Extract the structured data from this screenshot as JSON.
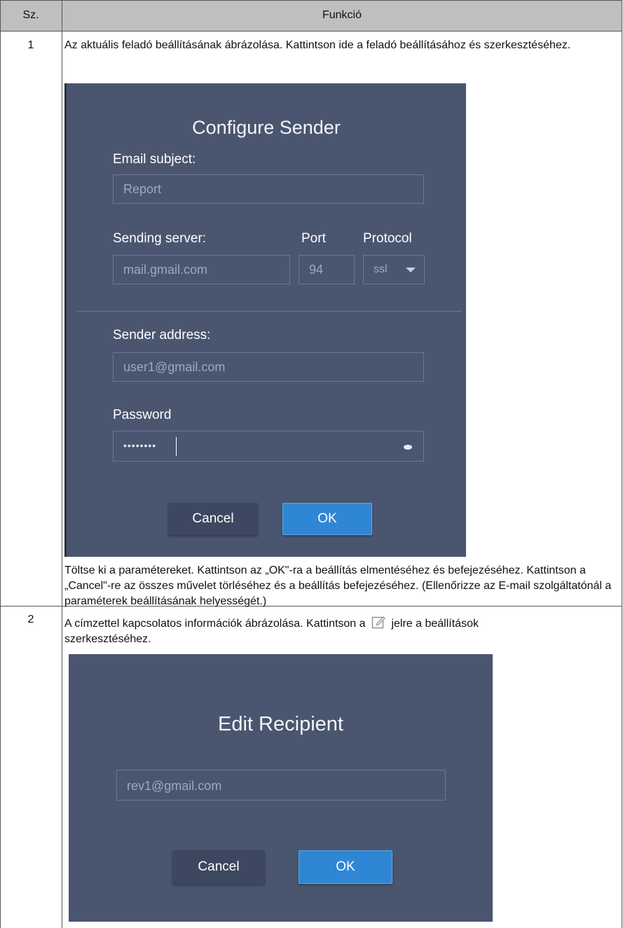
{
  "table": {
    "header": {
      "col1": "Sz.",
      "col2": "Funkció"
    },
    "rows": [
      {
        "number": "1",
        "intro": "Az aktuális feladó beállításának ábrázolása. Kattintson ide a feladó beállításához és szerkesztéséhez.",
        "dialog": {
          "title": "Configure Sender",
          "subject_label": "Email subject:",
          "subject_value": "Report",
          "server_label": "Sending server:",
          "server_value": "mail.gmail.com",
          "port_label": "Port",
          "port_value": "94",
          "protocol_label": "Protocol",
          "protocol_value": "ssl",
          "address_label": "Sender address:",
          "address_value": "user1@gmail.com",
          "password_label": "Password",
          "password_value": "••••••••",
          "cancel_label": "Cancel",
          "ok_label": "OK"
        },
        "outro": "Töltse ki a paramétereket. Kattintson az „OK\"-ra a beállítás elmentéséhez és befejezéséhez. Kattintson a „Cancel\"-re az összes művelet törléséhez és a beállítás befejezéséhez. (Ellenőrizze az E-mail szolgáltatónál a paraméterek beállításának helyességét.)"
      },
      {
        "number": "2",
        "intro_before_icon": "A címzettel kapcsolatos információk ábrázolása. Kattintson a",
        "intro_after_icon": "jelre a beállítások",
        "intro_line2": "szerkesztéséhez.",
        "dialog": {
          "title": "Edit Recipient",
          "email_value": "rev1@gmail.com",
          "cancel_label": "Cancel",
          "ok_label": "OK"
        }
      }
    ]
  },
  "colors": {
    "header_bg": "#bfbfbf",
    "dialog_bg": "#4a5670",
    "ok_button": "#2f86d4"
  }
}
